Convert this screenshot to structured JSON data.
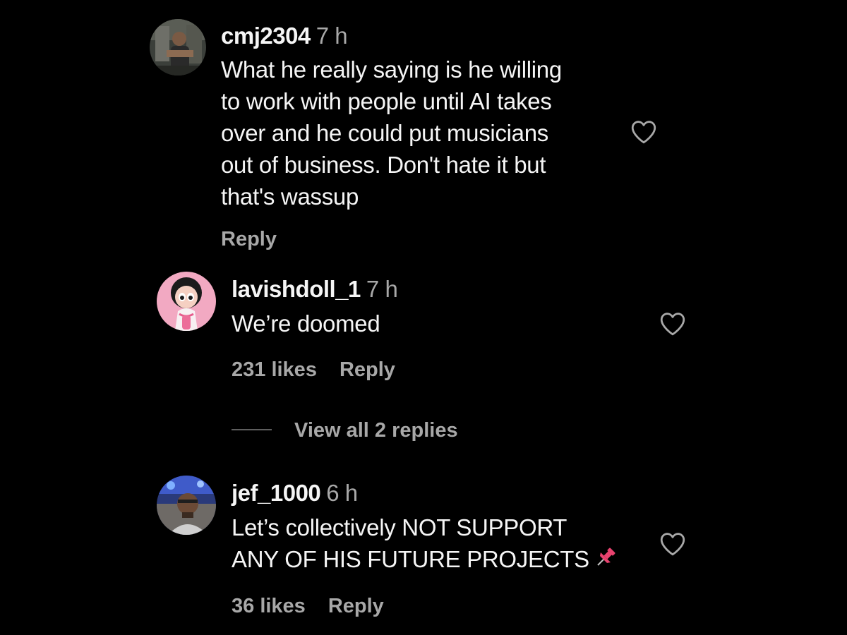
{
  "comments": [
    {
      "username": "cmj2304",
      "time": "7 h",
      "lines": [
        "What he really saying is he willing",
        "to work with people until AI takes",
        "over and he could put musicians",
        "out of business. Don't hate it but",
        "that's wassup"
      ],
      "likes": "",
      "reply_label": "Reply",
      "avatar_icon": "user-avatar-photo",
      "like_icon": "heart-outline-icon"
    },
    {
      "username": "lavishdoll_1",
      "time": "7 h",
      "lines": [
        "We’re doomed"
      ],
      "likes": "231 likes",
      "reply_label": "Reply",
      "view_replies": "View all 2 replies",
      "avatar_icon": "cartoon-avatar",
      "like_icon": "heart-outline-icon"
    },
    {
      "username": "jef_1000",
      "time": "6 h",
      "lines": [
        "Let’s collectively NOT SUPPORT",
        "ANY OF HIS FUTURE PROJECTS"
      ],
      "emoji": "pushpin-emoji",
      "likes": "36 likes",
      "reply_label": "Reply",
      "avatar_icon": "user-avatar-photo",
      "like_icon": "heart-outline-icon"
    }
  ],
  "colors": {
    "background": "#000000",
    "primary_text": "#f5f5f5",
    "secondary_text": "#a8a8a8",
    "divider": "#5e5e5e",
    "pin_red": "#e8436f"
  }
}
